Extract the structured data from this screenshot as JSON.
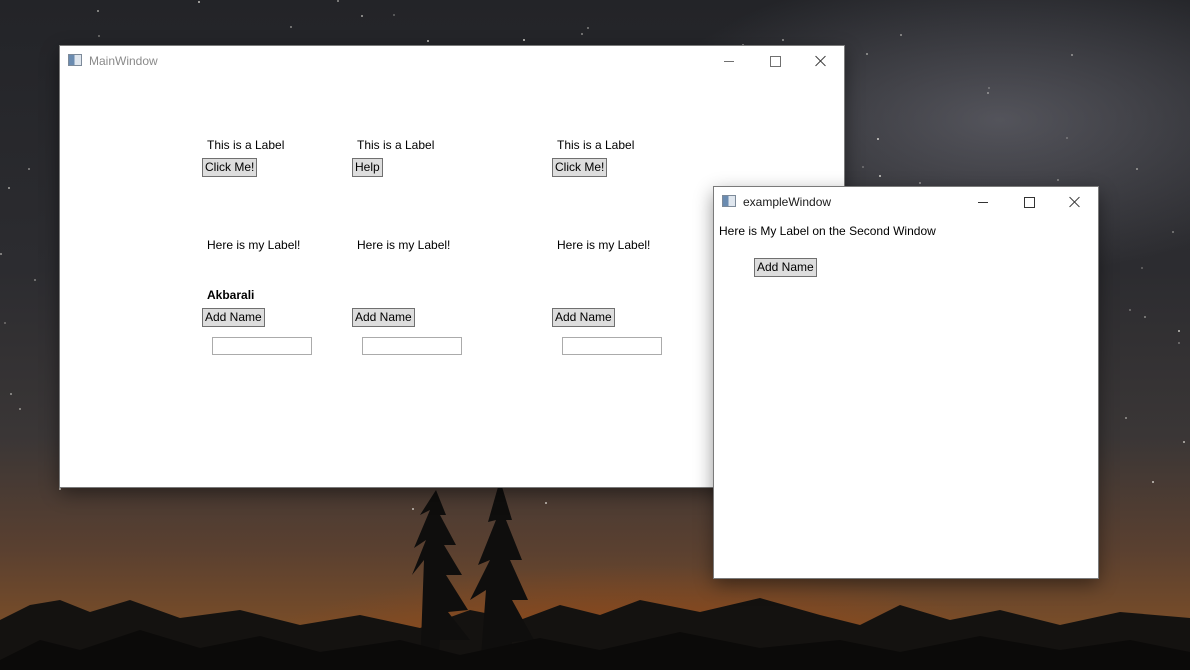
{
  "main_window": {
    "title": "MainWindow",
    "row1": [
      {
        "label": "This is a Label",
        "button": "Click Me!"
      },
      {
        "label": "This is a Label",
        "button": "Help"
      },
      {
        "label": "This is a Label",
        "button": "Click Me!"
      }
    ],
    "row2_labels": [
      "Here is my Label!",
      "Here is my Label!",
      "Here is my Label!"
    ],
    "name_label": "Akbarali",
    "add_buttons": [
      "Add Name",
      "Add Name",
      "Add Name"
    ],
    "inputs": [
      {
        "value": ""
      },
      {
        "value": ""
      },
      {
        "value": ""
      }
    ]
  },
  "example_window": {
    "title": "exampleWindow",
    "label": "Here is My Label on the Second Window",
    "button": "Add Name"
  }
}
